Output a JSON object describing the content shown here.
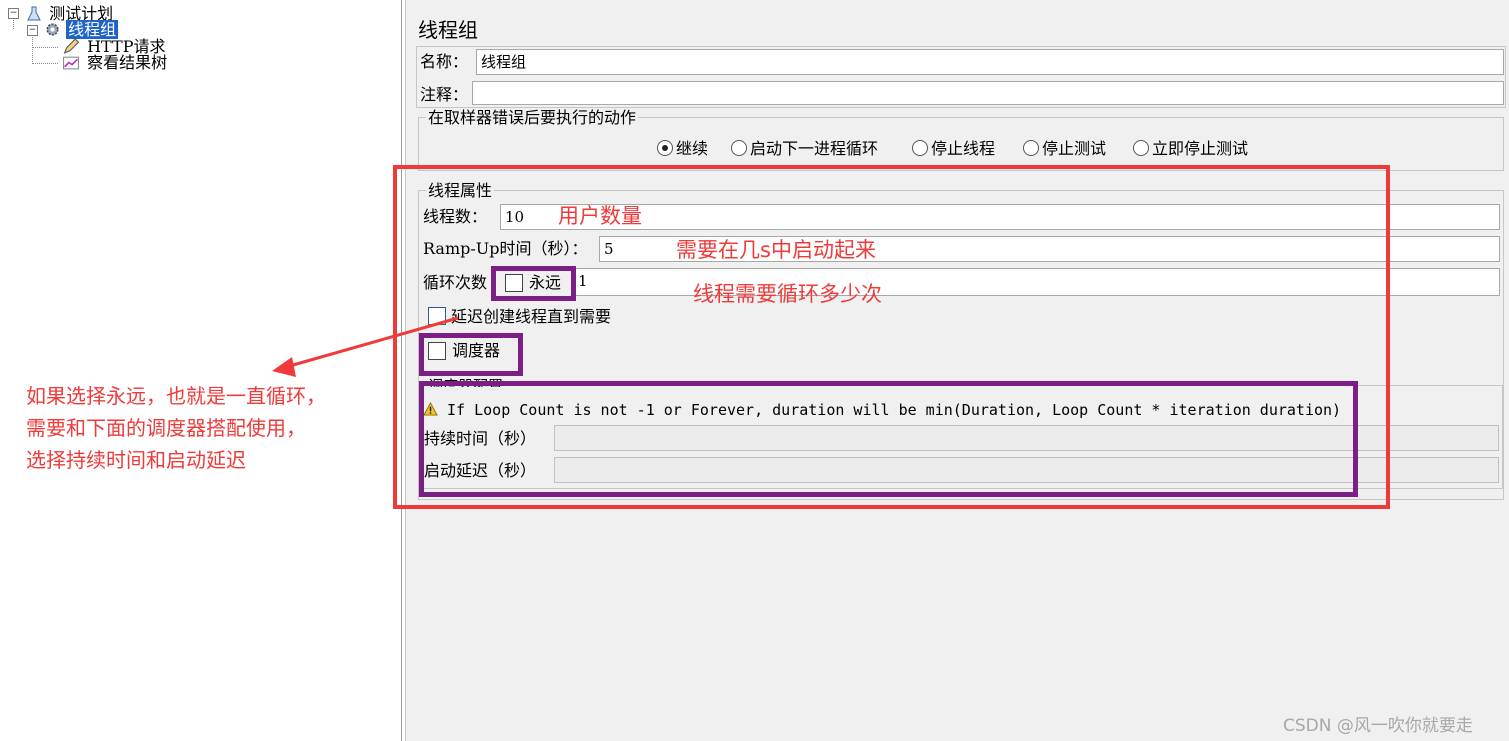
{
  "tree": {
    "root_label": "测试计划",
    "thread_group_label": "线程组",
    "children": [
      {
        "label": "HTTP请求",
        "icon": "pencil-icon"
      },
      {
        "label": "察看结果树",
        "icon": "chart-icon"
      }
    ]
  },
  "panel": {
    "title": "线程组",
    "name_label": "名称：",
    "name_value": "线程组",
    "comment_label": "注释：",
    "comment_value": "",
    "error_action_group": "在取样器错误后要执行的动作",
    "error_actions": [
      {
        "label": "继续",
        "selected": true
      },
      {
        "label": "启动下一进程循环",
        "selected": false
      },
      {
        "label": "停止线程",
        "selected": false
      },
      {
        "label": "停止测试",
        "selected": false
      },
      {
        "label": "立即停止测试",
        "selected": false
      }
    ],
    "thread_props_group": "线程属性",
    "threads_label": "线程数：",
    "threads_value": "10",
    "rampup_label": "Ramp-Up时间（秒）：",
    "rampup_value": "5",
    "loop_label": "循环次数",
    "forever_label": "永远",
    "forever_checked": false,
    "loop_value": "1",
    "delay_create_label": "延迟创建线程直到需要",
    "delay_create_checked": false,
    "scheduler_label": "调度器",
    "scheduler_checked": false,
    "scheduler_config_group": "调度器配置",
    "warning_text": "If Loop Count is not -1 or Forever, duration will be min(Duration, Loop Count * iteration duration)",
    "duration_label": "持续时间（秒）",
    "duration_value": "",
    "startup_delay_label": "启动延迟（秒）",
    "startup_delay_value": ""
  },
  "annotations": {
    "users": "用户数量",
    "rampup": "需要在几s中启动起来",
    "loops": "线程需要循环多少次",
    "left_line1": "如果选择永远，也就是一直循环，",
    "left_line2": "需要和下面的调度器搭配使用，",
    "left_line3": "选择持续时间和启动延迟"
  },
  "colors": {
    "annotation_red": "#f03a3a",
    "annotation_purple": "#7b1f86",
    "selection_blue": "#1e64c8"
  },
  "watermark": "CSDN @风一吹你就要走"
}
